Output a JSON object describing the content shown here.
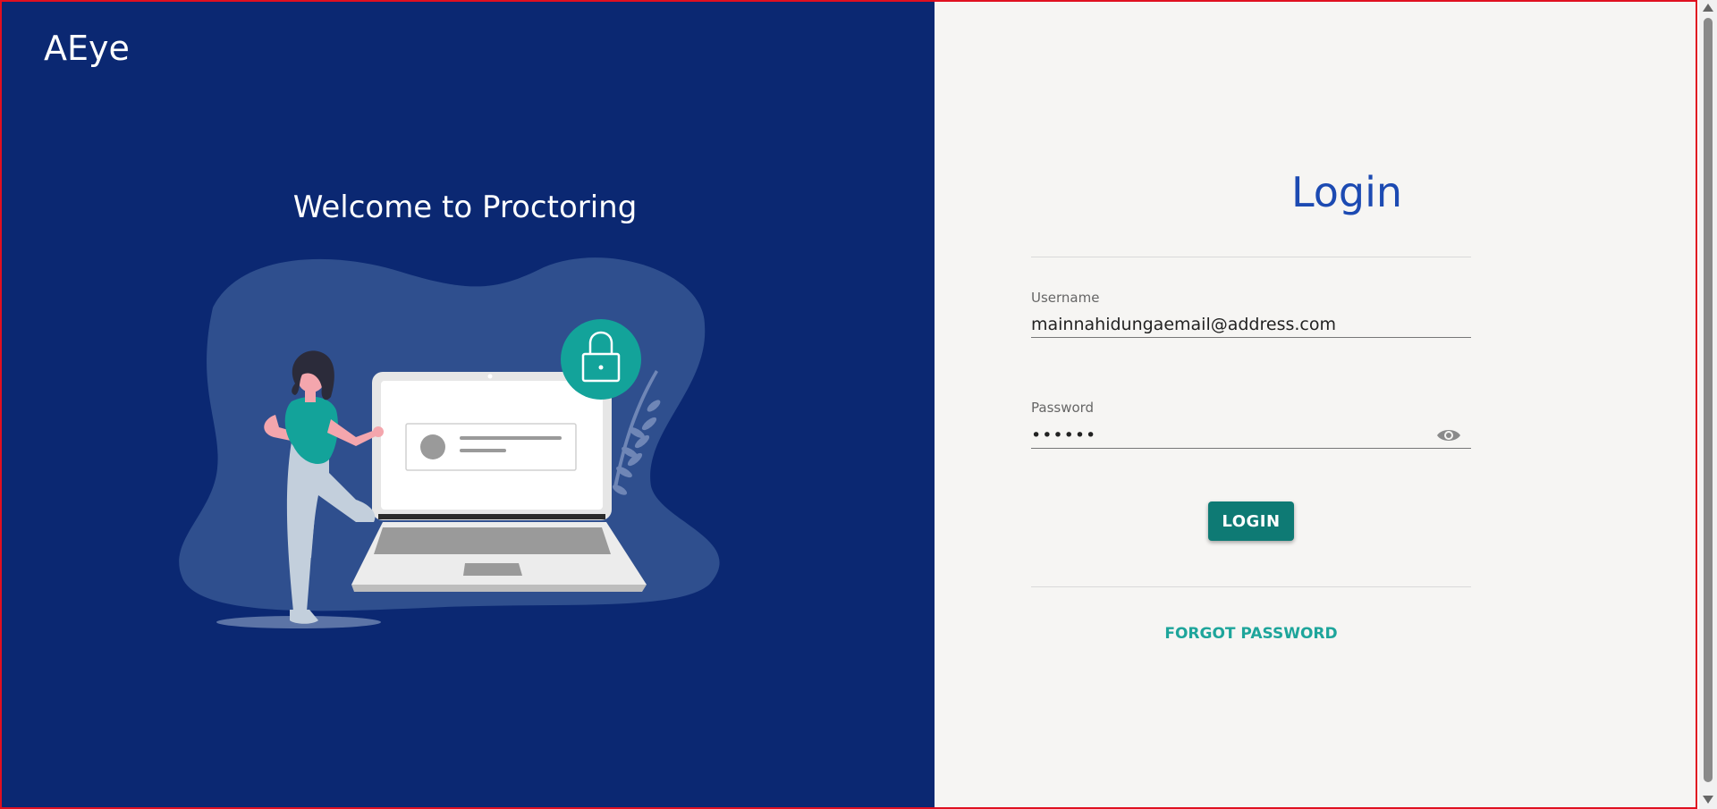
{
  "brand": {
    "name": "AEye"
  },
  "hero": {
    "welcome_text": "Welcome to Proctoring",
    "illustration_icon": "lock-laptop-illustration"
  },
  "login": {
    "title": "Login",
    "username": {
      "label": "Username",
      "value": "mainnahidungaemail@address.com"
    },
    "password": {
      "label": "Password",
      "value": "••••••",
      "toggle_icon": "eye-icon"
    },
    "submit_label": "LOGIN",
    "forgot_label": "FORGOT PASSWORD"
  },
  "colors": {
    "left_panel_bg": "#0b2872",
    "right_panel_bg": "#f6f5f3",
    "title_blue": "#1c4ab2",
    "button_teal": "#0e7a74",
    "link_teal": "#1ea59b",
    "frame_border": "#e01020"
  }
}
